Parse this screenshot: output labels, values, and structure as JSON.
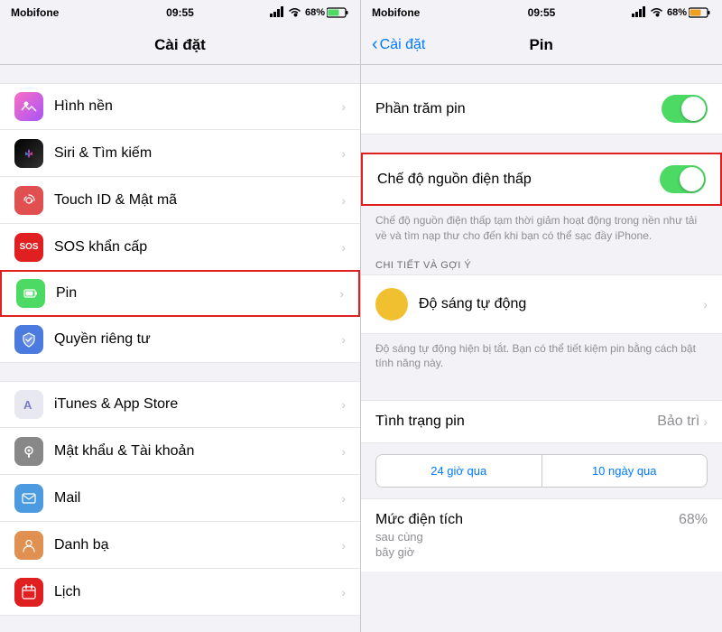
{
  "left": {
    "statusBar": {
      "carrier": "Mobifone",
      "time": "09:55",
      "battery": "68%"
    },
    "navTitle": "Cài đặt",
    "items": [
      {
        "id": "wallpaper",
        "label": "Hình nền",
        "iconBg": "wallpaper",
        "icon": "🌄"
      },
      {
        "id": "siri",
        "label": "Siri & Tìm kiếm",
        "iconBg": "siri",
        "icon": "✦"
      },
      {
        "id": "touchid",
        "label": "Touch ID & Mật mã",
        "iconBg": "touchid",
        "icon": "👆"
      },
      {
        "id": "sos",
        "label": "SOS khẩn cấp",
        "iconBg": "sos",
        "icon": "SOS"
      },
      {
        "id": "battery",
        "label": "Pin",
        "iconBg": "battery",
        "icon": "🔋",
        "highlighted": true
      },
      {
        "id": "privacy",
        "label": "Quyền riêng tư",
        "iconBg": "privacy",
        "icon": "✋"
      },
      {
        "id": "itunes",
        "label": "iTunes & App Store",
        "iconBg": "itunes",
        "icon": "A"
      },
      {
        "id": "password",
        "label": "Mật khẩu & Tài khoản",
        "iconBg": "password",
        "icon": "🔑"
      },
      {
        "id": "mail",
        "label": "Mail",
        "iconBg": "mail",
        "icon": "✉"
      },
      {
        "id": "contacts",
        "label": "Danh bạ",
        "iconBg": "contacts",
        "icon": "👤"
      },
      {
        "id": "calendar",
        "label": "Lịch",
        "iconBg": "calendar",
        "icon": "📅"
      }
    ]
  },
  "right": {
    "statusBar": {
      "carrier": "Mobifone",
      "time": "09:55",
      "battery": "68%"
    },
    "backLabel": "Cài đặt",
    "pageTitle": "Pin",
    "sections": {
      "phantramPin": {
        "label": "Phần trăm pin",
        "toggleOn": true
      },
      "cheDoNguon": {
        "label": "Chế độ nguồn điện thấp",
        "toggleOn": true,
        "highlighted": true,
        "desc": "Chế độ nguồn điện thấp tạm thời giảm hoạt động trong nền như tải về và tìm nạp thư cho đến khi bạn có thể sạc đầy iPhone."
      },
      "chiTietHeader": "CHI TIẾT VÀ GỢI Ý",
      "doSang": {
        "label": "Độ sáng tự động",
        "desc": "Độ sáng tự động hiện bị tắt. Bạn có thể tiết kiệm pin bằng cách bật tính năng này."
      },
      "tinhTrang": {
        "label": "Tình trạng pin",
        "value": "Bảo trì"
      },
      "tabs": {
        "tab1": "24 giờ qua",
        "tab2": "10 ngày qua"
      },
      "mucDien": {
        "title": "Mức điện tích",
        "subtitle": "sau cùng",
        "subtitle2": "bây giờ",
        "value": "68%"
      }
    }
  }
}
